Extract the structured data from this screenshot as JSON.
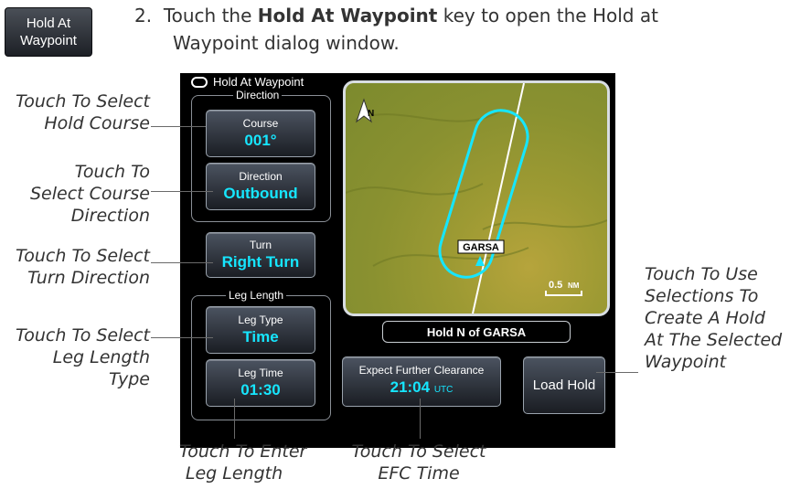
{
  "key": {
    "line1": "Hold At",
    "line2": "Waypoint"
  },
  "step": {
    "number": "2.",
    "prefix": "Touch the ",
    "bold": "Hold At Waypoint",
    "suffix": " key to open the Hold at",
    "line2": "Waypoint dialog window."
  },
  "dialog": {
    "title": "Hold At Waypoint",
    "direction_group": "Direction",
    "course": {
      "label": "Course",
      "value": "001°"
    },
    "direction": {
      "label": "Direction",
      "value": "Outbound"
    },
    "turn": {
      "label": "Turn",
      "value": "Right Turn"
    },
    "leg_length_group": "Leg Length",
    "leg_type": {
      "label": "Leg Type",
      "value": "Time"
    },
    "leg_time": {
      "label": "Leg Time",
      "value": "01:30"
    },
    "efc": {
      "label": "Expect Further Clearance",
      "value": "21:04",
      "unit": "UTC"
    },
    "load_hold": "Load Hold",
    "hold_name": "Hold N of GARSA",
    "map": {
      "north": "N",
      "waypoint": "GARSA",
      "scale": "0.5",
      "scale_unit": "NM"
    }
  },
  "callouts": {
    "hold_course": [
      "Touch To Select",
      "Hold Course"
    ],
    "course_direction": [
      "Touch To",
      "Select Course",
      "Direction"
    ],
    "turn_direction": [
      "Touch To Select",
      "Turn Direction"
    ],
    "leg_length_type": [
      "Touch To Select",
      "Leg Length",
      "Type"
    ],
    "leg_length": [
      "Touch To Enter",
      "Leg Length"
    ],
    "efc_time": [
      "Touch To Select",
      "EFC Time"
    ],
    "create_hold": [
      "Touch To Use",
      "Selections To",
      "Create A Hold",
      "At The Selected",
      "Waypoint"
    ]
  },
  "colors": {
    "cyan": "#16e6ff",
    "screen_bg": "#000000"
  }
}
